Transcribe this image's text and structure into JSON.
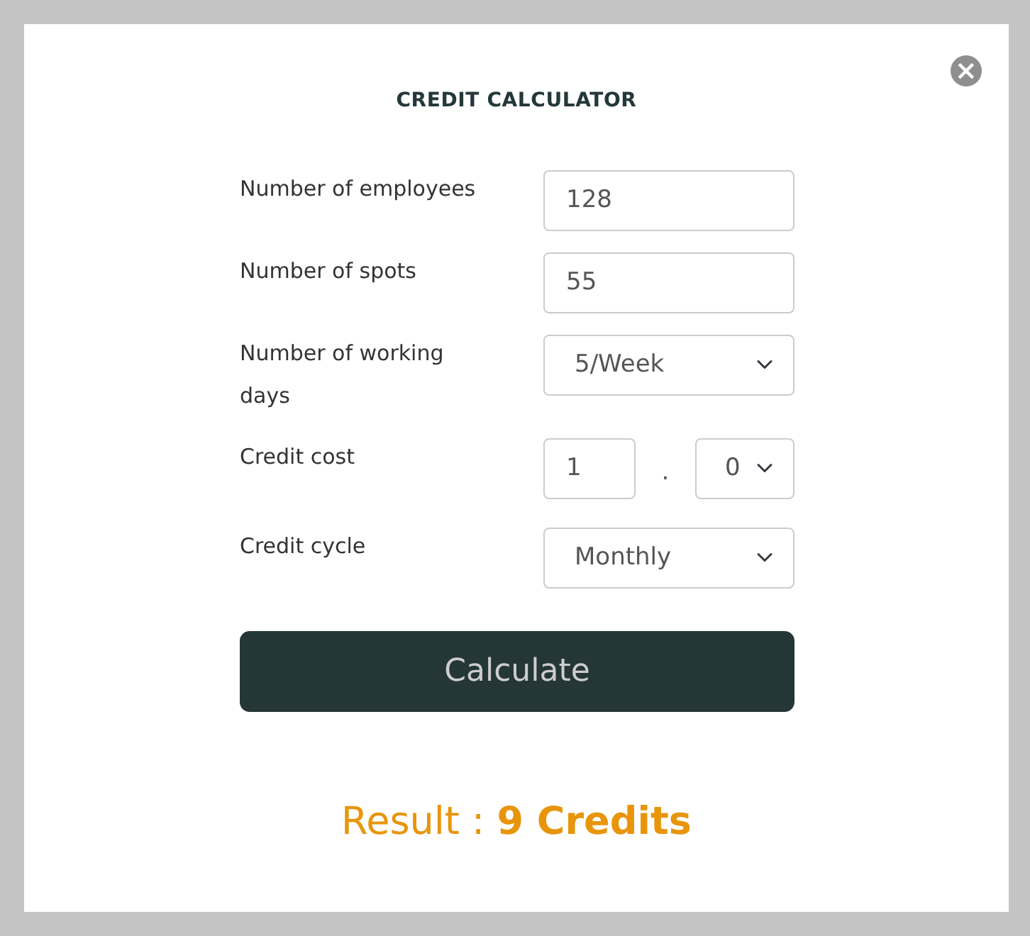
{
  "dialog": {
    "title": "CREDIT CALCULATOR",
    "close": "×"
  },
  "fields": [
    {
      "kind": "input",
      "label": "Number of employees",
      "value": "128"
    },
    {
      "kind": "input",
      "label": "Number of spots",
      "value": "55"
    },
    {
      "kind": "select",
      "label": "Number of working days",
      "value": "5/Week"
    },
    {
      "kind": "decimal",
      "label": "Credit cost",
      "whole": "1",
      "separator": ".",
      "fraction": "0"
    },
    {
      "kind": "select",
      "label": "Credit cycle",
      "value": "Monthly"
    }
  ],
  "button": "Calculate",
  "result": "Result : **9 Credits**"
}
